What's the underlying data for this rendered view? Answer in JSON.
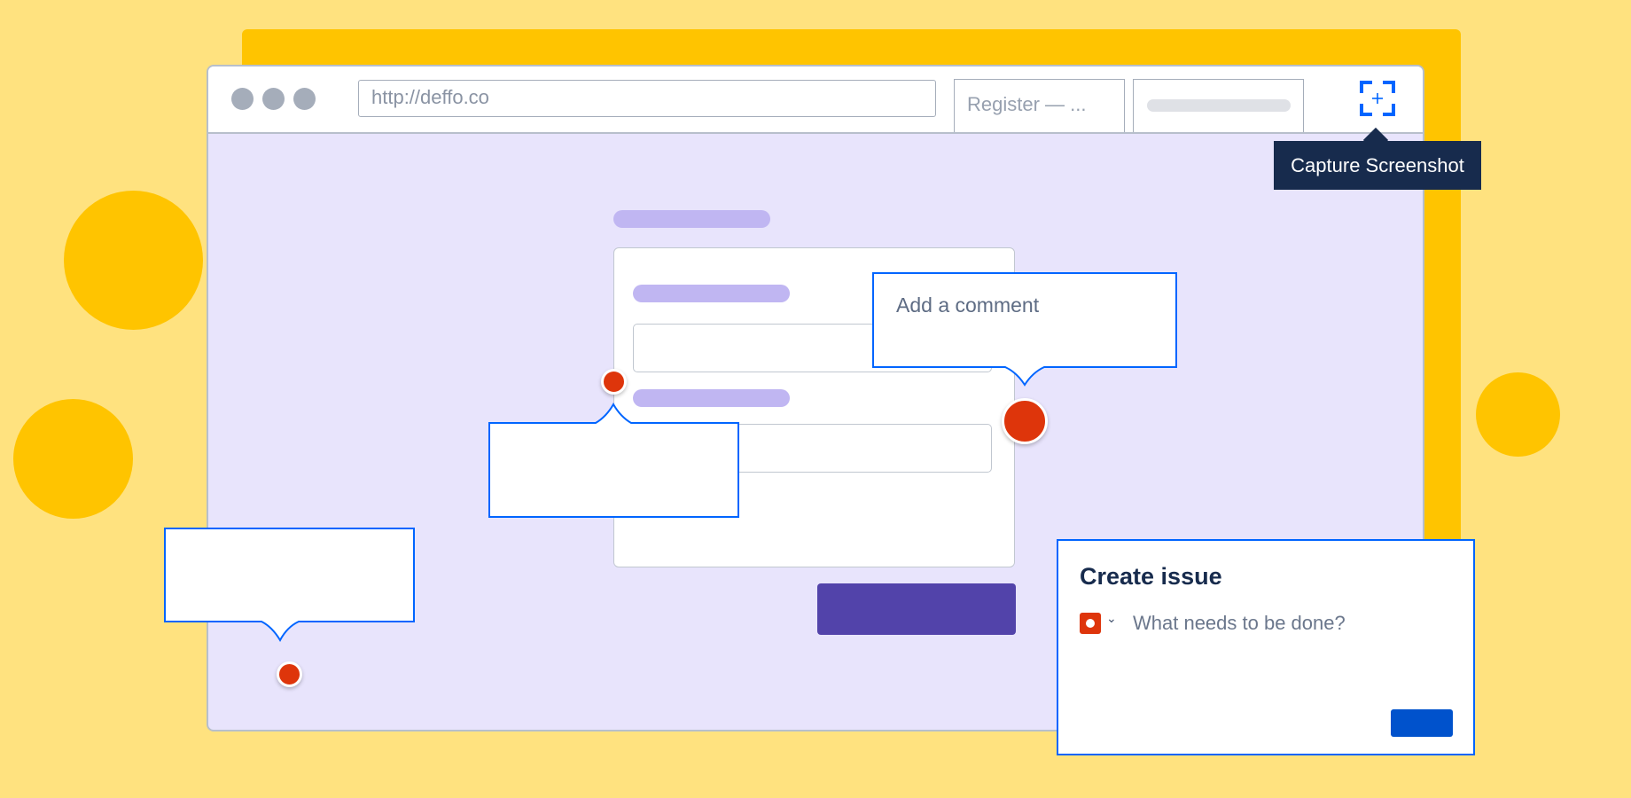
{
  "browser": {
    "url": "http://deffo.co",
    "tabs": [
      {
        "label": "Register — ..."
      },
      {
        "label": ""
      }
    ]
  },
  "capture": {
    "icon": "capture-screenshot-icon",
    "tooltip": "Capture Screenshot"
  },
  "comment": {
    "placeholder": "Add a comment"
  },
  "issue": {
    "title": "Create issue",
    "issue_type_icon": "bug-icon",
    "summary_placeholder": "What needs to be done?"
  },
  "colors": {
    "background": "#FFE27F",
    "accent_yellow": "#FFC400",
    "page_bg": "#E8E4FC",
    "primary_button": "#5243AA",
    "pin_red": "#DE350B",
    "focus_blue": "#0065FF",
    "tooltip_bg": "#172B4D"
  }
}
